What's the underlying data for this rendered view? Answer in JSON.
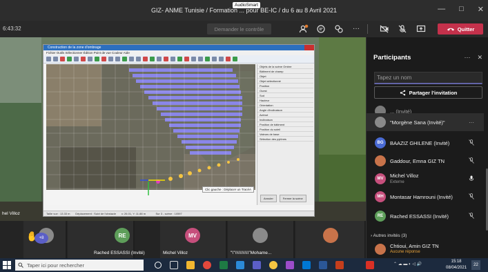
{
  "window": {
    "title": "GIZ- ANME Tunisie / Formation ... pour BE-IC / du 6 au 8 Avril 2021",
    "overlay_badge": "AudioSmart",
    "minimize": "—",
    "maximize": "□",
    "close": "✕"
  },
  "toolbar": {
    "timer": "6:43:32",
    "request_control": "Demander le contrôle",
    "quit_label": "Quitter",
    "more": "···"
  },
  "shared_screen": {
    "presenter_name": "hel Villoz",
    "app_title": "Construction de la zone d'ombrage",
    "app_menu": "Fichier   Outils   Sélectionner   Édition   Point de vue   Couleur   Aide",
    "panel_tabs": "Objets de la scène   Ombre",
    "panel_rows": [
      "Bâtiment de champ",
      "Objet",
      "Objet sélectionné",
      "Position",
      "Ouest",
      "Sud",
      "Hauteur",
      "Orientation",
      "Angle d'inclinaison",
      "Azimut",
      "Inclinaison",
      "Position de bâtiment",
      "Position du soleil",
      "Valeurs de base",
      "Sélection des pylônes"
    ],
    "panel_btn_cancel": "Annuler",
    "panel_btn_ok": "Fermer la scène",
    "status_left": "Taille vue : 13.33 m",
    "status_mid": "Déplacement : Suivi de l'obstacle",
    "status_right": "x: 26.01, Y: 11.88 m",
    "status_end": "Sur 3 - scène : 10597",
    "place_message": "Clic gauche : Déplacer un TracéA"
  },
  "participants": {
    "title": "Participants",
    "search_placeholder": "Tapez un nom",
    "share_label": "Partager l'invitation",
    "items": [
      {
        "initials": "",
        "name": "... (Invité)",
        "sub": "",
        "color": "#7a7a7a"
      },
      {
        "initials": "",
        "name": "\"Morgène Sana (Invité)\"",
        "sub": "",
        "color": "#8a8a8a"
      },
      {
        "initials": "BG",
        "name": "BAAZIZ GHILENE (Invité)",
        "sub": "",
        "color": "#4a6bd4"
      },
      {
        "initials": "",
        "name": "Gaddour, Emna GIZ TN",
        "sub": "",
        "color": "#c8734a"
      },
      {
        "initials": "MV",
        "name": "Michel Villoz",
        "sub": "Externe",
        "color": "#c64f7c"
      },
      {
        "initials": "MH",
        "name": "Montasar Hamrouni (Invité)",
        "sub": "",
        "color": "#c64f7c"
      },
      {
        "initials": "RE",
        "name": "Rached ESSASSI (Invité)",
        "sub": "",
        "color": "#5e9e5a"
      }
    ],
    "others_label": "Autres invités (3)",
    "last_item": {
      "name": "Chtioui, Amin GIZ TN",
      "sub": "Aucune réponse"
    }
  },
  "strip": {
    "raised_hands": "+8",
    "tiles": [
      {
        "initials": "",
        "label": "",
        "color": "#8a8a8a"
      },
      {
        "initials": "RE",
        "label": "Rached ESSASSI (Invité)",
        "color": "#5e9e5a"
      },
      {
        "initials": "MV",
        "label": "Michel Villoz",
        "color": "#c64f7c"
      },
      {
        "initials": "",
        "label": "\"\\\"\\\\\\\\\\\\\\\\\\\\\\\"Mohame...",
        "color": "#8a8a8a"
      },
      {
        "initials": "",
        "label": "",
        "color": "#c8734a"
      }
    ]
  },
  "taskbar": {
    "search_placeholder": "Taper ici pour rechercher",
    "time": "15:18",
    "date": "08/04/2021",
    "notifications": "22"
  }
}
